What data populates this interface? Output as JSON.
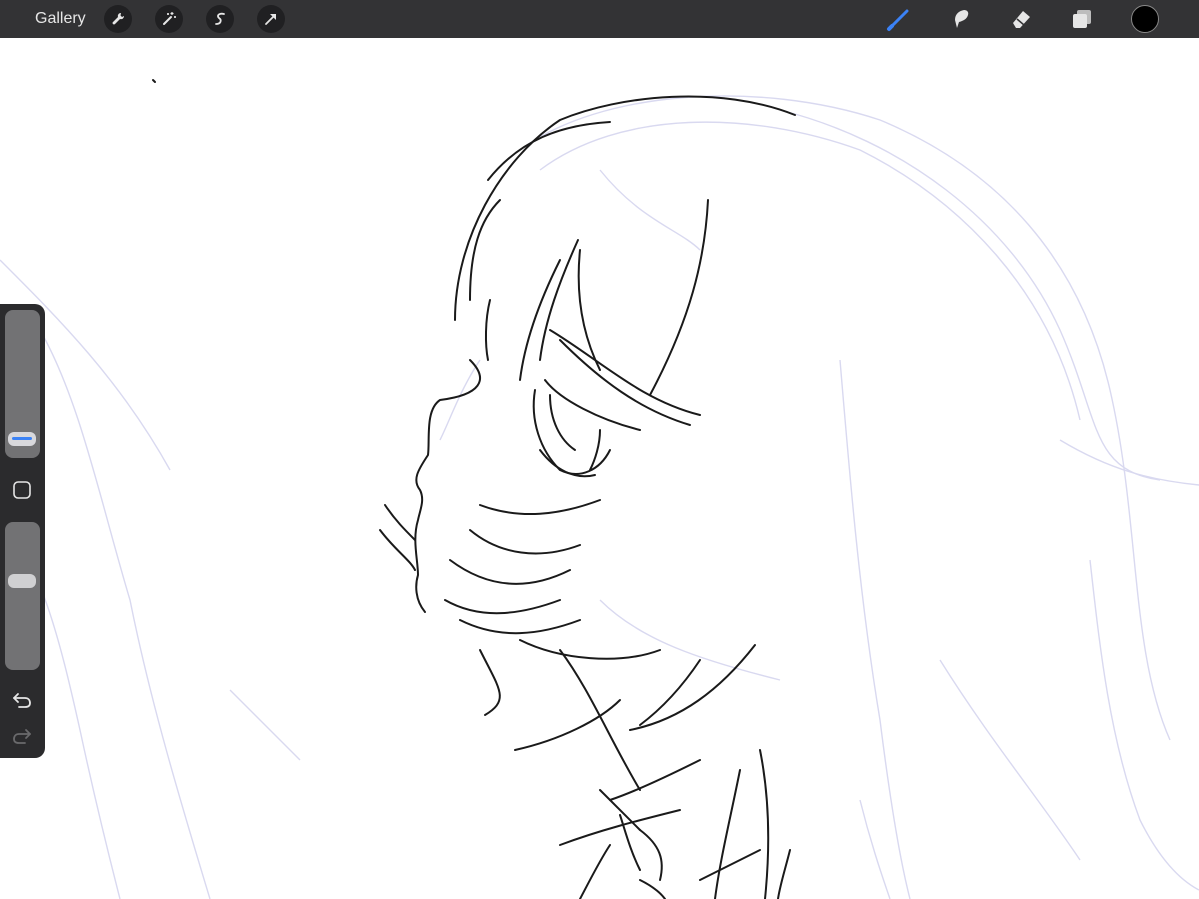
{
  "app": {
    "gallery_label": "Gallery"
  },
  "toolbar": {
    "left_tools": [
      {
        "name": "actions",
        "icon": "wrench-icon"
      },
      {
        "name": "adjustments",
        "icon": "magic-wand-icon"
      },
      {
        "name": "selection",
        "icon": "selection-s-icon"
      },
      {
        "name": "transform",
        "icon": "arrow-cursor-icon"
      }
    ],
    "right_tools": [
      {
        "name": "brush",
        "icon": "brush-icon",
        "active": true
      },
      {
        "name": "smudge",
        "icon": "smudge-icon",
        "active": false
      },
      {
        "name": "eraser",
        "icon": "eraser-icon",
        "active": false
      },
      {
        "name": "layers",
        "icon": "layers-icon",
        "active": false
      }
    ],
    "active_color": "#000000",
    "accent_color": "#3b82f6"
  },
  "sidebar": {
    "brush_size_level": 0.85,
    "opacity_level": 0.6,
    "modify_icon": "square-icon",
    "undo_icon": "undo-icon",
    "redo_icon": "redo-icon"
  }
}
